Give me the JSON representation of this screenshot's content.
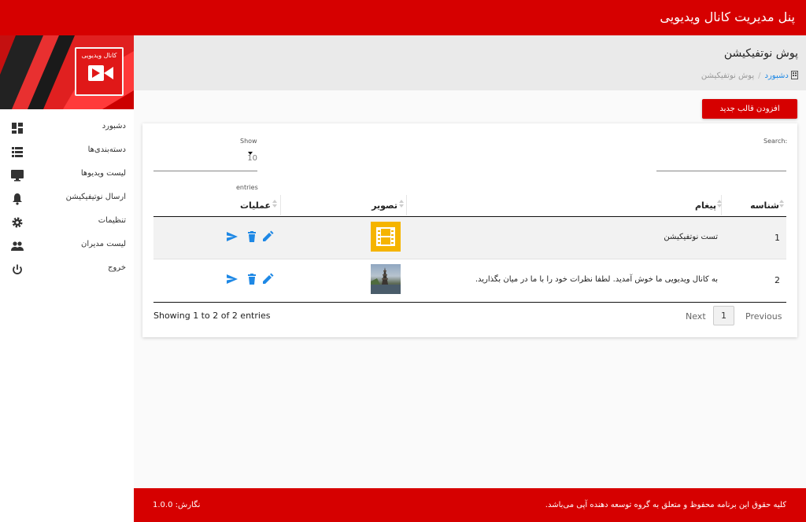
{
  "app": {
    "title": "پنل مدیریت کانال ویدیویی"
  },
  "logo": {
    "text": "کانال ویدیویی"
  },
  "sidebar": {
    "items": [
      {
        "label": "دشبورد",
        "icon": "dashboard-icon"
      },
      {
        "label": "دسته‌بندی‌ها",
        "icon": "list-icon"
      },
      {
        "label": "لیست ویدیوها",
        "icon": "monitor-icon"
      },
      {
        "label": "ارسال نوتیفیکیشن",
        "icon": "bell-icon"
      },
      {
        "label": "تنظیمات",
        "icon": "gear-icon"
      },
      {
        "label": "لیست مدیران",
        "icon": "people-icon"
      },
      {
        "label": "خروج",
        "icon": "power-icon"
      }
    ]
  },
  "header": {
    "title": "پوش نوتفیکیشن",
    "breadcrumb": {
      "home": "دشبورد",
      "current": "پوش نوتفیکیشن"
    }
  },
  "toolbar": {
    "add_label": "افزودن قالب جدید"
  },
  "table": {
    "search_label": "Search:",
    "show_label": "Show",
    "length_value": "10",
    "entries_label": "entries",
    "columns": [
      "شناسه",
      "پیغام",
      "تصویر",
      "عملیات"
    ],
    "rows": [
      {
        "id": "1",
        "message": "تست نوتفیکیشن",
        "image": "film-icon"
      },
      {
        "id": "2",
        "message": "به کانال ویدیویی ما خوش آمدید. لطفا نظرات خود را با ما در میان بگذارید.",
        "image": "landscape-photo"
      }
    ],
    "info": "Showing 1 to 2 of 2 entries",
    "pagination": {
      "next": "Next",
      "current": "1",
      "previous": "Previous"
    }
  },
  "footer": {
    "copyright": "کلیه حقوق این برنامه محفوظ و متعلق به گروه توسعه دهنده آپی می‌باشد.",
    "version": "نگارش: 1.0.0"
  },
  "colors": {
    "brand": "#d60000",
    "accent": "#1e88e5",
    "thumb_yellow": "#f5b400"
  }
}
